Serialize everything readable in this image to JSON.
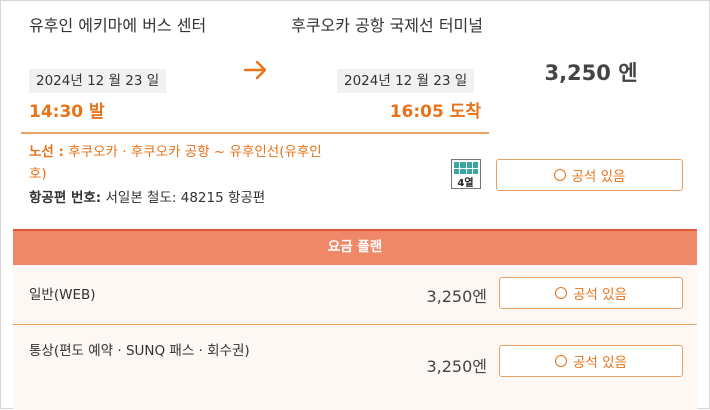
{
  "trip": {
    "departure": {
      "name": "유후인 에키마에 버스 센터",
      "date": "2024년 12 월 23 일",
      "time": "14:30 발"
    },
    "arrival": {
      "name": "후쿠오카 공항 국제선 터미널",
      "date": "2024년 12 월 23 일",
      "time": "16:05 도착"
    },
    "price": "3,250 엔",
    "route_label": "노선 :",
    "route_value": "후쿠오카 · 후쿠오카 공항 ~ 유후인선(유후인호)",
    "flight_label": "항공편 번호:",
    "flight_value": "서일본 철도: 48215 항공편",
    "seat_layout_label": "4열",
    "seat_button": "공석 있음"
  },
  "plans": {
    "header": "요금 플랜",
    "rows": [
      {
        "name": "일반(WEB)",
        "price": "3,250엔",
        "button": "공석 있음"
      },
      {
        "name": "통상(편도 예약 · SUNQ 패스 · 회수권)",
        "price": "3,250엔",
        "button": "공석 있음"
      }
    ]
  },
  "colors": {
    "accent": "#e8731a",
    "header_bg": "#ef8868",
    "header_border": "#e0563a",
    "seat_grid": "#3aa8a0"
  },
  "icons": {
    "direction": "arrow-right-icon",
    "seat_layout": "seat-4-row-icon",
    "availability": "circle-icon"
  }
}
